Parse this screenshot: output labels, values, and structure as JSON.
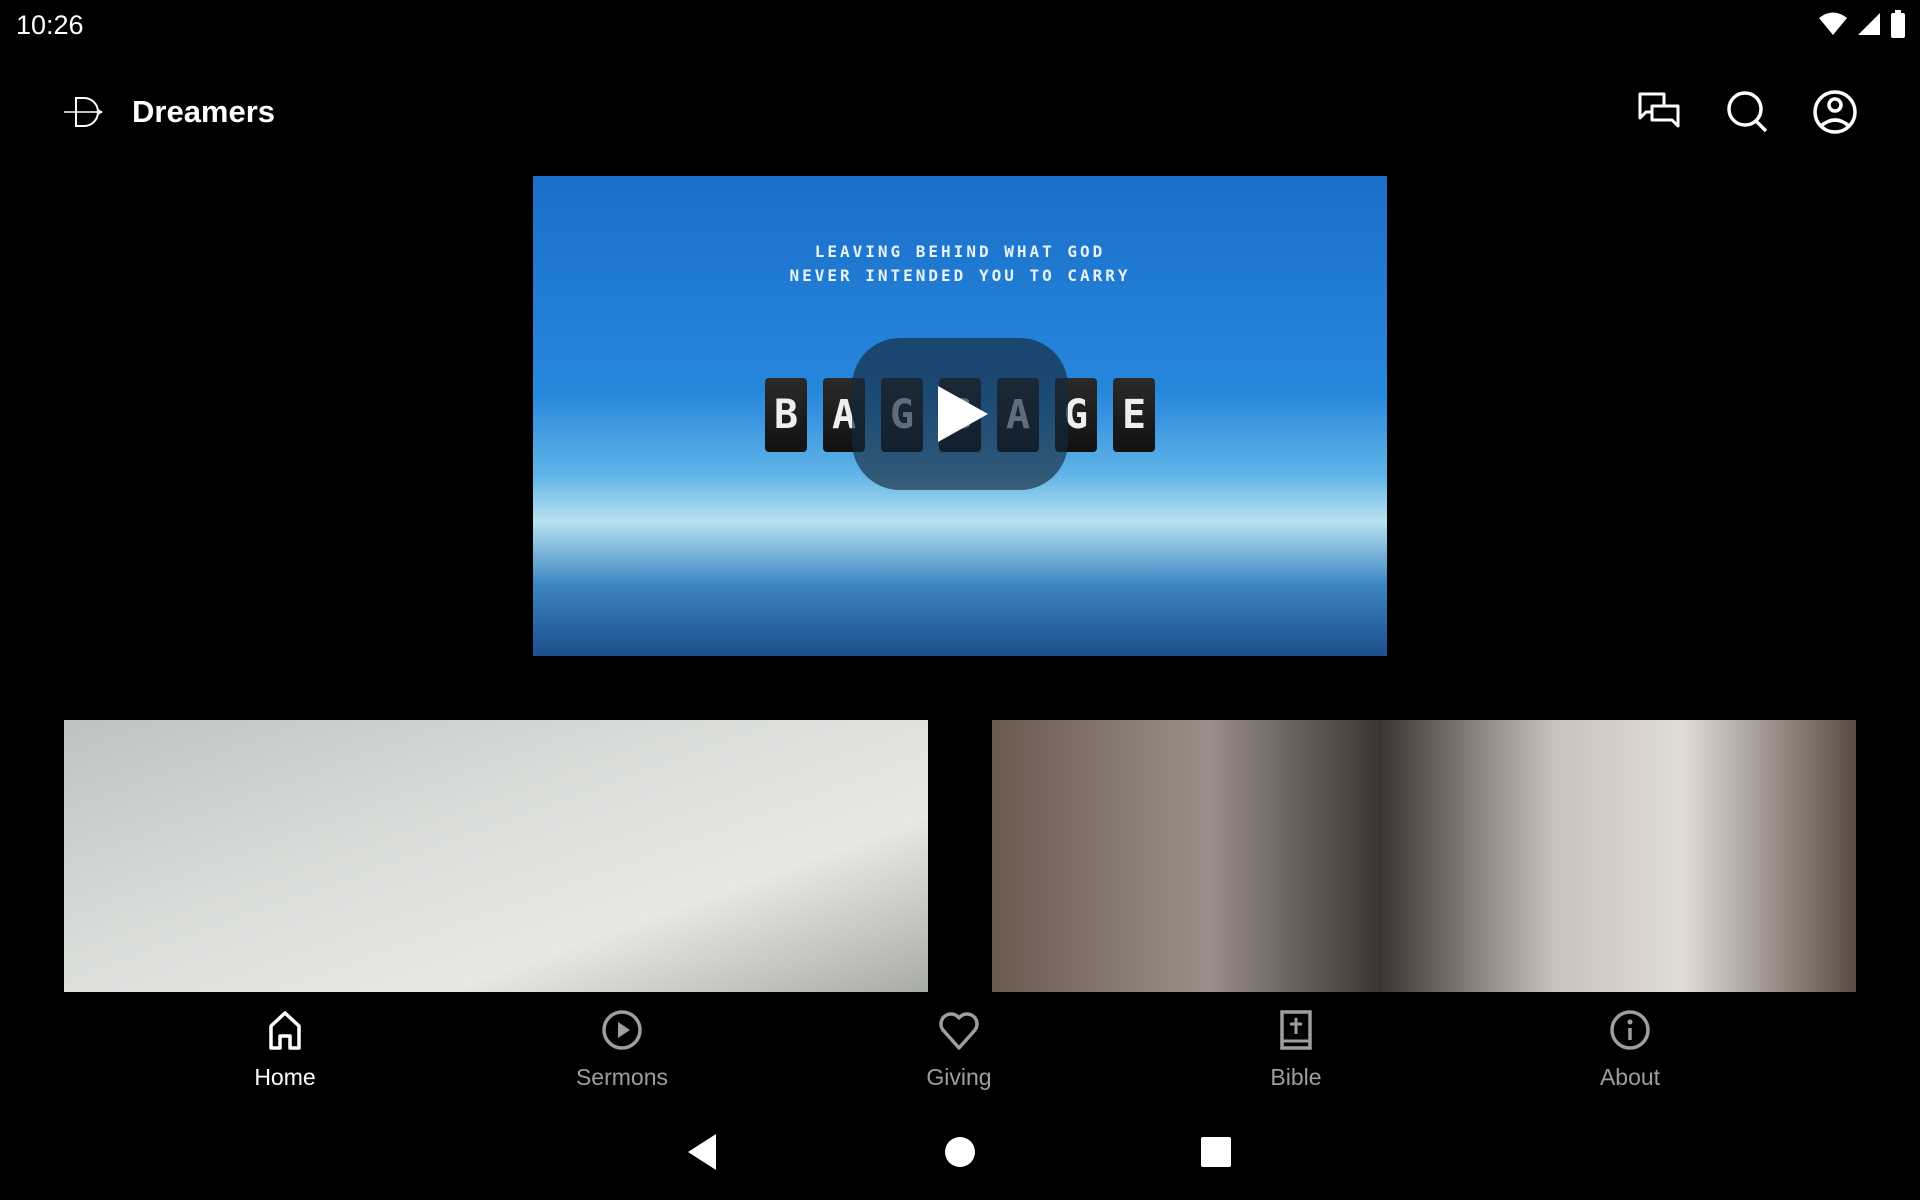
{
  "status_bar": {
    "time": "10:26",
    "icons": [
      "wifi-icon",
      "signal-icon",
      "battery-icon"
    ]
  },
  "header": {
    "title": "Dreamers",
    "logo": "bow-arrow-logo",
    "actions": [
      "chat-icon",
      "search-icon",
      "profile-icon"
    ]
  },
  "hero": {
    "line1": "LEAVING BEHIND WHAT GOD",
    "line2": "NEVER INTENDED YOU TO CARRY",
    "letters": [
      "B",
      "A",
      "G",
      "G",
      "A",
      "G",
      "E"
    ]
  },
  "cards": [
    {
      "image": "notebook-photo"
    },
    {
      "image": "church-crowd-photo"
    }
  ],
  "bottom_nav": [
    {
      "label": "Home",
      "icon": "home-icon",
      "active": true
    },
    {
      "label": "Sermons",
      "icon": "play-circle-icon",
      "active": false
    },
    {
      "label": "Giving",
      "icon": "heart-icon",
      "active": false
    },
    {
      "label": "Bible",
      "icon": "bible-icon",
      "active": false
    },
    {
      "label": "About",
      "icon": "info-icon",
      "active": false
    }
  ],
  "colors": {
    "active": "#ffffff",
    "inactive": "#9e9e9e",
    "background": "#000000"
  }
}
